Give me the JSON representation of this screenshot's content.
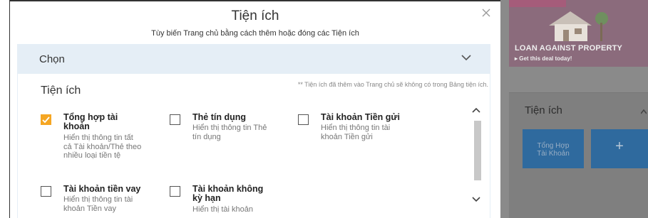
{
  "modal": {
    "title": "Tiện ích",
    "subtitle": "Tùy biến Trang chủ bằng cách thêm hoặc đóng các Tiện ích",
    "select_label": "Chọn",
    "panel_title": "Tiện ích",
    "panel_note": "** Tiện ích đã thêm vào Trang chủ sẽ không có trong Bảng tiện ích."
  },
  "widgets": [
    {
      "checked": true,
      "title_1": "Tổng hợp tài",
      "title_2": "khoản",
      "desc_1": "Hiển thị thông tin tất",
      "desc_2": "cả Tài khoản/Thẻ theo",
      "desc_3": "nhiều loại tiền tệ"
    },
    {
      "checked": false,
      "title_1": "Thẻ tín dụng",
      "desc_1": "Hiển thị thông tin Thẻ",
      "desc_2": "tín dụng"
    },
    {
      "checked": false,
      "title_1": "Tài khoản Tiền gửi",
      "desc_1": "Hiển thị thông tin tài",
      "desc_2": "khoản Tiền gửi"
    },
    {
      "checked": false,
      "title_1": "Tài khoản tiền vay",
      "desc_1": "Hiển thị thông tin tài",
      "desc_2": "khoản Tiền vay"
    },
    {
      "checked": false,
      "title_1": "Tài khoản không",
      "title_2": "kỳ hạn",
      "desc_1": "Hiển thị tài khoản"
    }
  ],
  "background": {
    "banner_line1": "LOAN AGAINST PROPERTY",
    "banner_line2": "▸ Get this deal today!",
    "side_title": "Tiện ích",
    "tile_line1": "Tổng Hợp",
    "tile_line2": "Tài Khoản",
    "add_tile": "+"
  },
  "colors": {
    "accent": "#f5a623",
    "select_bg": "#e5eef6",
    "tile": "#2f6a9e"
  }
}
